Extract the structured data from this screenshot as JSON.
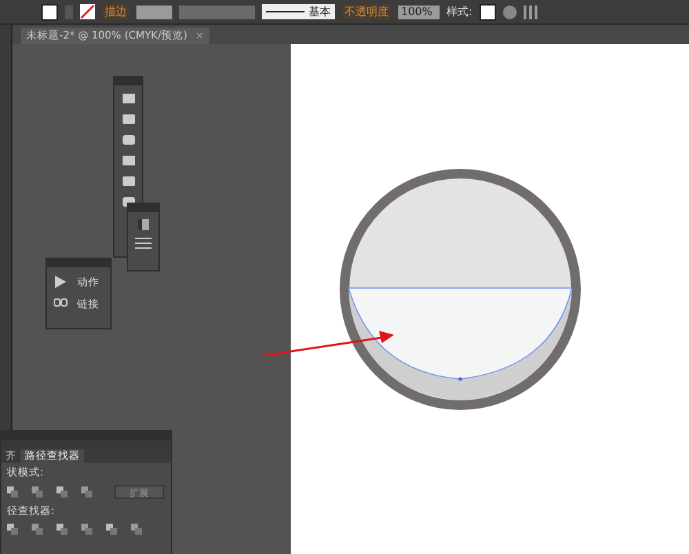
{
  "toolbar": {
    "stroke_label": "描边",
    "brush": "基本",
    "opacity_label": "不透明度",
    "opacity": "100%",
    "style_label": "样式:"
  },
  "document_tab": {
    "title": "未标题-2* @ 100% (CMYK/预览)",
    "close": "×"
  },
  "actions_panel": {
    "items": [
      {
        "kind": "play",
        "label": "动作"
      },
      {
        "kind": "link",
        "label": "链接"
      }
    ]
  },
  "pathfinder_panel": {
    "tabs": [
      {
        "label": "齐",
        "selected": false
      },
      {
        "label": "路径查找器",
        "selected": true
      }
    ],
    "shape_modes_label": "状模式:",
    "expand_button": "扩展",
    "pathfinders_label": "径查找器:"
  }
}
